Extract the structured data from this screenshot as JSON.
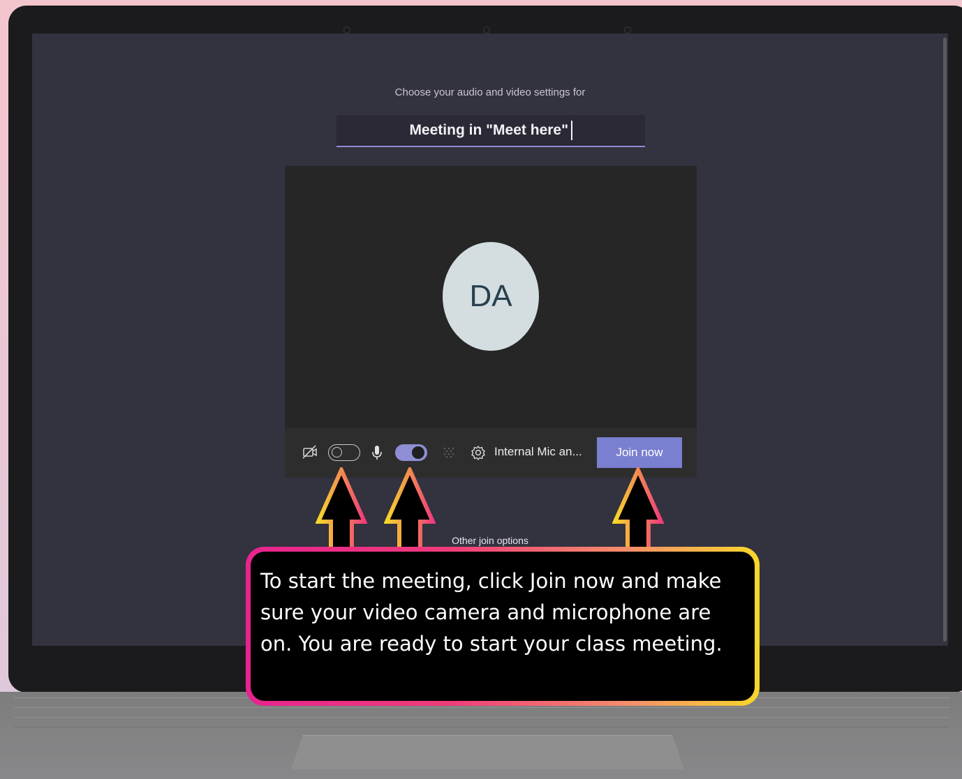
{
  "meeting": {
    "subtitle": "Choose your audio and video settings for",
    "title": "Meeting in \"Meet here\""
  },
  "preview": {
    "avatar_initials": "DA"
  },
  "controls": {
    "camera_icon": "camera-off-icon",
    "camera_toggle": "off",
    "mic_icon": "microphone-icon",
    "mic_toggle": "on",
    "blur_icon": "background-blur-icon",
    "settings_icon": "gear-icon",
    "device_label": "Internal Mic an...",
    "join_label": "Join now"
  },
  "other_join_options": "Other join options",
  "callout": {
    "text": "To start the meeting, click Join now and make sure your video camera and microphone are on. You are ready to start your class meeting."
  },
  "colors": {
    "screen_bg": "#33323f",
    "accent": "#7b7fd0",
    "callout_gradient": [
      "#e8238f",
      "#f7d72a"
    ]
  }
}
